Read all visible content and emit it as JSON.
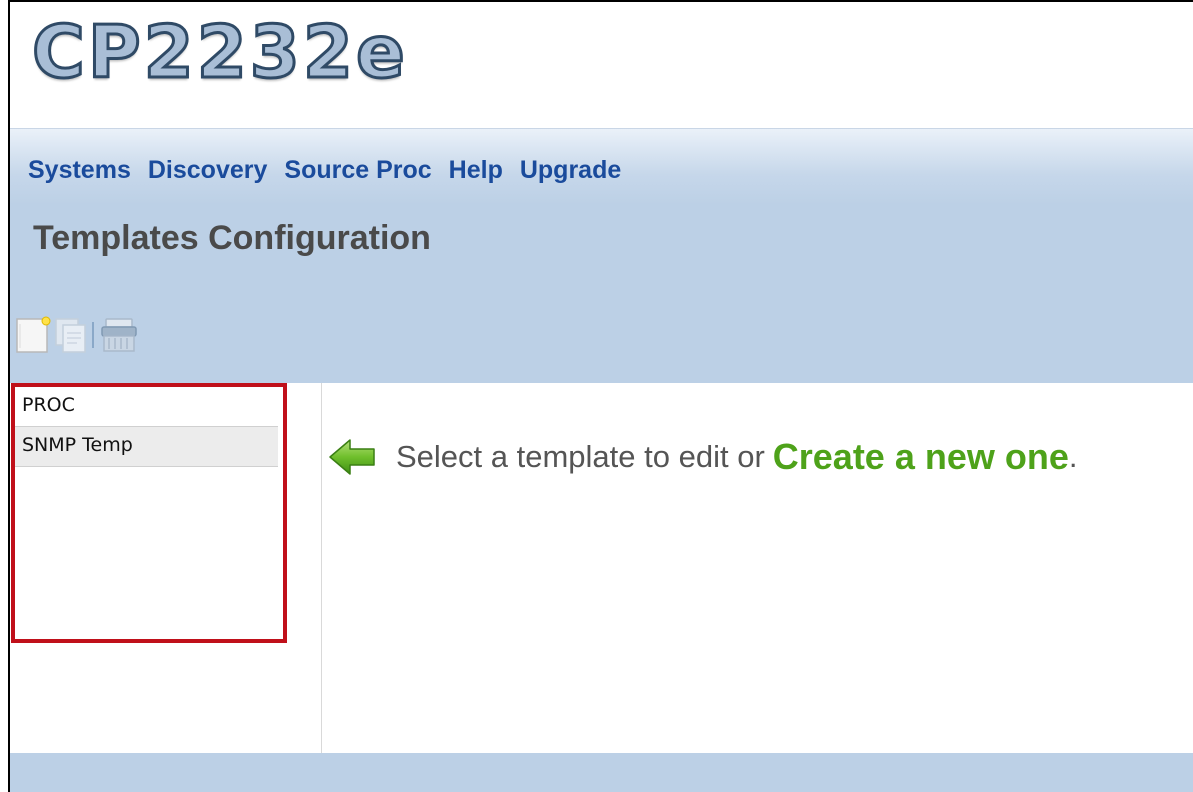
{
  "app": {
    "logo_text": "CP2232e"
  },
  "menu": {
    "items": [
      {
        "label": "Systems"
      },
      {
        "label": "Discovery"
      },
      {
        "label": "Source Proc"
      },
      {
        "label": "Help"
      },
      {
        "label": "Upgrade"
      }
    ]
  },
  "page": {
    "title": "Templates Configuration"
  },
  "toolbar": {
    "buttons": [
      {
        "icon": "new-document-icon"
      },
      {
        "icon": "copy-document-icon"
      },
      {
        "icon": "delete-shredder-icon"
      }
    ]
  },
  "templates": {
    "items": [
      {
        "label": "PROC"
      },
      {
        "label": "SNMP Temp"
      }
    ]
  },
  "message": {
    "text": "Select a template to edit or",
    "link": "Create a new one",
    "suffix": "."
  },
  "colors": {
    "menu_link": "#1a4b9c",
    "panel_bg": "#bcd0e6",
    "create_link": "#4ea21a",
    "highlight": "#c0101a"
  }
}
